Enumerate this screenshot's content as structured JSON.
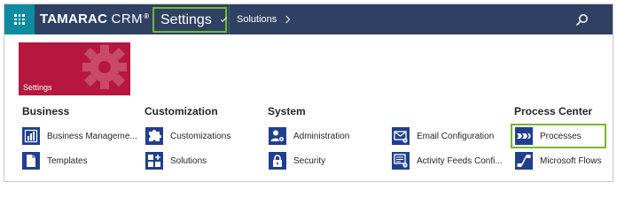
{
  "header": {
    "brand_name": "TAMARAC",
    "brand_suffix": "CRM",
    "brand_mark": "®",
    "area_menu_label": "Settings",
    "breadcrumb": "Solutions"
  },
  "tile": {
    "label": "Settings",
    "color": "#b6173e"
  },
  "groups": [
    {
      "title": "Business",
      "items": [
        {
          "label": "Business Manageme...",
          "icon": "bar-chart-icon"
        },
        {
          "label": "Templates",
          "icon": "document-icon"
        }
      ]
    },
    {
      "title": "Customization",
      "items": [
        {
          "label": "Customizations",
          "icon": "puzzle-icon"
        },
        {
          "label": "Solutions",
          "icon": "solutions-icon"
        }
      ]
    },
    {
      "title": "System",
      "items": [
        {
          "label": "Administration",
          "icon": "users-gear-icon"
        },
        {
          "label": "Security",
          "icon": "lock-icon"
        }
      ]
    },
    {
      "title": "",
      "items": [
        {
          "label": "Email Configuration",
          "icon": "envelope-gear-icon"
        },
        {
          "label": "Activity Feeds Confi...",
          "icon": "feed-config-icon"
        }
      ]
    },
    {
      "title": "Process Center",
      "items": [
        {
          "label": "Processes",
          "icon": "process-arrows-icon"
        },
        {
          "label": "Microsoft Flows",
          "icon": "flow-icon"
        }
      ]
    }
  ],
  "colors": {
    "nav_bar": "#2f4163",
    "apps_button": "#0f8ba0",
    "icon_blue": "#213f8f",
    "highlight_outline": "#74b72e"
  }
}
